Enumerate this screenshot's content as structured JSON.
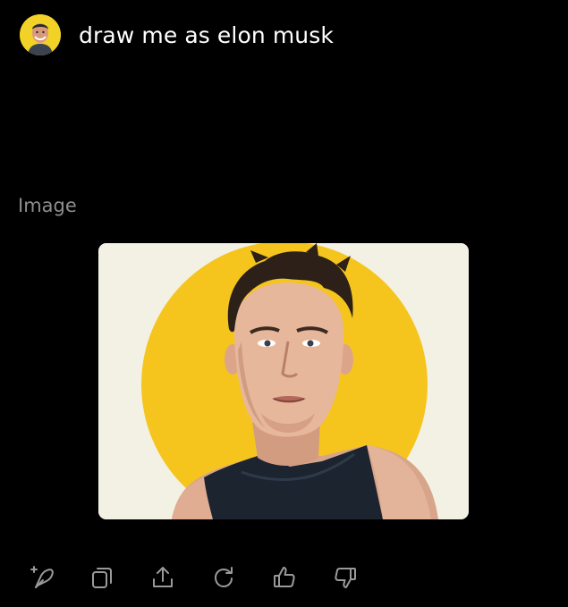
{
  "prompt": {
    "avatar_icon": "user-avatar",
    "text": "draw me as elon musk"
  },
  "result": {
    "label": "Image",
    "image_icon": "generated-portrait-image",
    "colors": {
      "card_background": "#f3f1e4",
      "sun_circle": "#f5c51e",
      "shirt": "#1c2430",
      "hair": "#2c2018",
      "skin": "#e7b79b"
    }
  },
  "actions": [
    {
      "icon": "edit-sparkle-icon"
    },
    {
      "icon": "copy-icon"
    },
    {
      "icon": "share-icon"
    },
    {
      "icon": "regenerate-icon"
    },
    {
      "icon": "thumbs-up-icon"
    },
    {
      "icon": "thumbs-down-icon"
    }
  ]
}
